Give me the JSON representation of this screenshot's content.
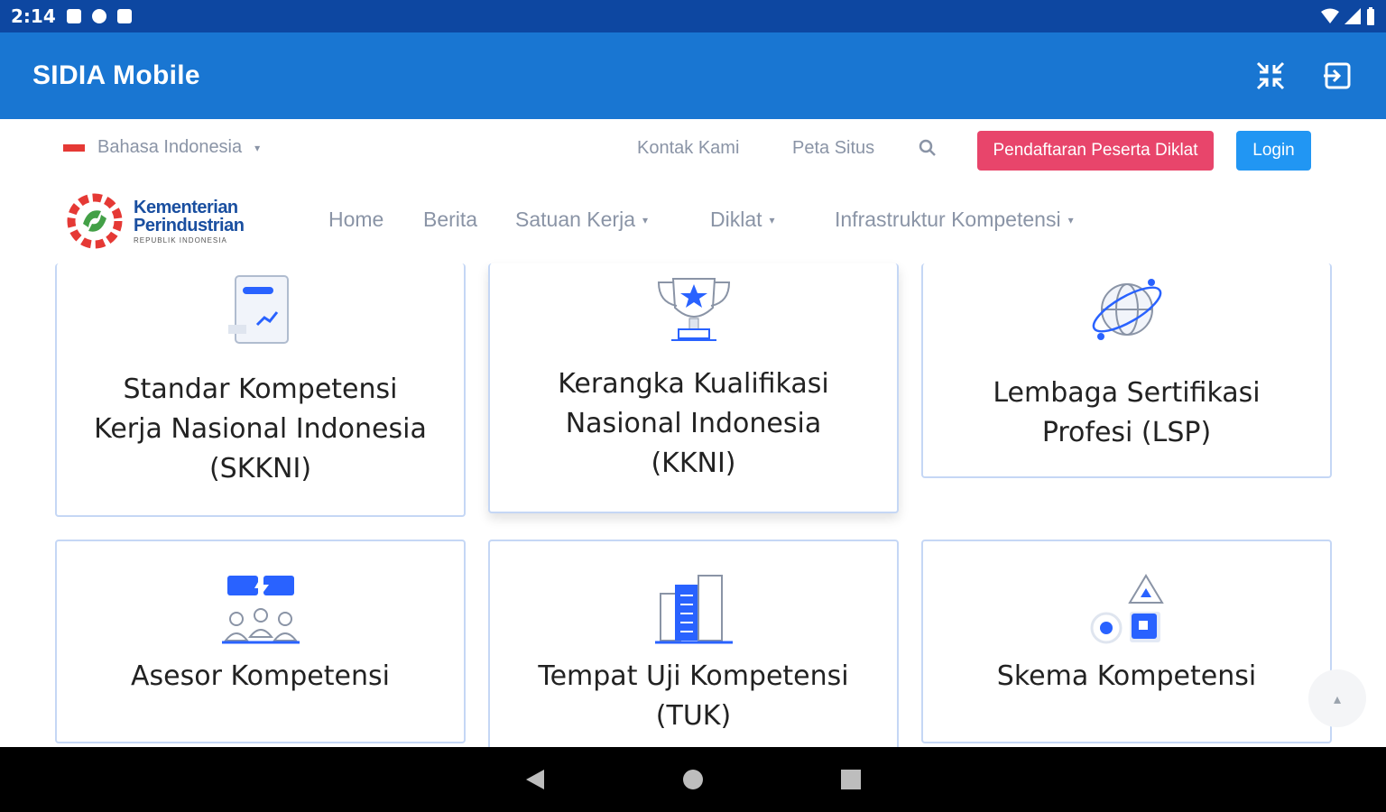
{
  "status_bar": {
    "time": "2:14"
  },
  "app_bar": {
    "title": "SIDIA Mobile"
  },
  "topbar": {
    "language": "Bahasa Indonesia",
    "contact": "Kontak Kami",
    "sitemap": "Peta Situs",
    "register_button": "Pendaftaran Peserta Diklat",
    "login_button": "Login"
  },
  "logo": {
    "line1": "Kementerian",
    "line2": "Perindustrian",
    "line3": "REPUBLIK INDONESIA"
  },
  "nav": {
    "items": [
      {
        "label": "Home"
      },
      {
        "label": "Berita"
      },
      {
        "label": "Satuan Kerja"
      },
      {
        "label": "Diklat"
      },
      {
        "label": "Infrastruktur Kompetensi"
      }
    ]
  },
  "cards": [
    {
      "title": "Standar Kompetensi\nKerja Nasional Indonesia\n(SKKNI)",
      "icon": "document-chart-icon"
    },
    {
      "title": "Kerangka Kualifikasi\nNasional Indonesia\n(KKNI)",
      "icon": "trophy-icon"
    },
    {
      "title": "Lembaga Sertifikasi\nProfesi (LSP)",
      "icon": "globe-icon"
    },
    {
      "title": "Asesor Kompetensi",
      "icon": "assessor-group-icon"
    },
    {
      "title": "Tempat Uji Kompetensi\n(TUK)",
      "icon": "building-icon"
    },
    {
      "title": "Skema Kompetensi",
      "icon": "shapes-icon"
    }
  ],
  "colors": {
    "primary": "#1976d2",
    "status": "#0d47a1",
    "accent": "#e8456b",
    "login": "#2196f3",
    "icon_blue": "#2962ff"
  }
}
